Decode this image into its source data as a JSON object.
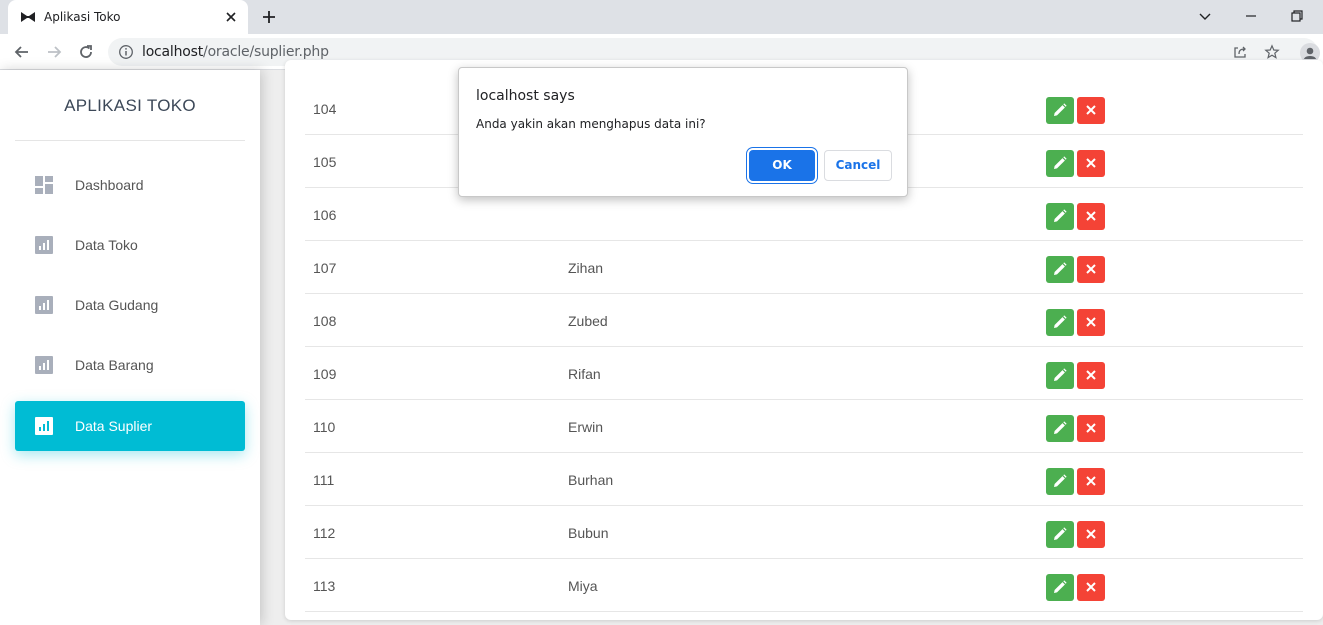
{
  "browser": {
    "tab_title": "Aplikasi Toko",
    "url_host": "localhost",
    "url_path": "/oracle/suplier.php"
  },
  "sidebar": {
    "brand": "APLIKASI TOKO",
    "items": [
      {
        "label": "Dashboard",
        "icon": "dashboard-icon",
        "active": false
      },
      {
        "label": "Data Toko",
        "icon": "bar-chart-icon",
        "active": false
      },
      {
        "label": "Data Gudang",
        "icon": "bar-chart-icon",
        "active": false
      },
      {
        "label": "Data Barang",
        "icon": "bar-chart-icon",
        "active": false
      },
      {
        "label": "Data Suplier",
        "icon": "bar-chart-icon",
        "active": true
      }
    ]
  },
  "table": {
    "rows": [
      {
        "id": "104",
        "name": ""
      },
      {
        "id": "105",
        "name": ""
      },
      {
        "id": "106",
        "name": ""
      },
      {
        "id": "107",
        "name": "Zihan"
      },
      {
        "id": "108",
        "name": "Zubed"
      },
      {
        "id": "109",
        "name": "Rifan"
      },
      {
        "id": "110",
        "name": "Erwin"
      },
      {
        "id": "111",
        "name": "Burhan"
      },
      {
        "id": "112",
        "name": "Bubun"
      },
      {
        "id": "113",
        "name": "Miya"
      }
    ]
  },
  "dialog": {
    "title": "localhost says",
    "message": "Anda yakin akan menghapus data ini?",
    "ok_label": "OK",
    "cancel_label": "Cancel"
  },
  "colors": {
    "accent": "#00bcd4",
    "edit": "#4caf50",
    "delete": "#f44336",
    "dialog_primary": "#1a73e8"
  }
}
